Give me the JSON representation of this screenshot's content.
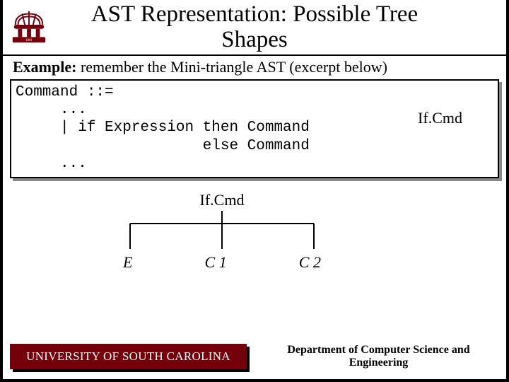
{
  "title_line1": "AST Representation: Possible Tree",
  "title_line2": "Shapes",
  "subtitle_bold": "Example:",
  "subtitle_rest": " remember the Mini-triangle AST (excerpt below)",
  "code": {
    "l1": "Command ::=",
    "l2": "     ...",
    "l3": "     | if Expression then Command",
    "l4": "                     else Command",
    "l5": "     ...",
    "ifcmd": "If.Cmd"
  },
  "tree": {
    "root": "If.Cmd",
    "leaves": [
      "E",
      "C 1",
      "C 2"
    ]
  },
  "footer": {
    "left": "UNIVERSITY OF SOUTH CAROLINA",
    "right": "Department of Computer Science and Engineering"
  }
}
